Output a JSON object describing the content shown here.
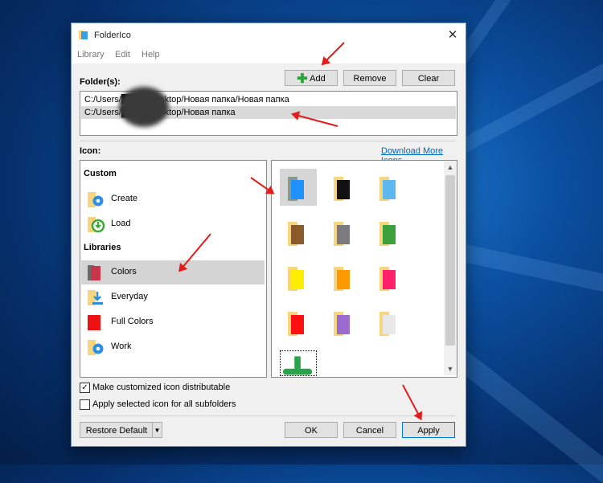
{
  "window": {
    "title": "FolderIco"
  },
  "menu": [
    "Library",
    "Edit",
    "Help"
  ],
  "folders": {
    "label": "Folder(s):",
    "add_label": "Add",
    "remove_label": "Remove",
    "clear_label": "Clear",
    "paths": [
      "C:/Users/████/Desktop/Новая папка/Новая папка",
      "C:/Users/████/Desktop/Новая папка"
    ],
    "selected_index": 1
  },
  "icon": {
    "label": "Icon:",
    "download_link": "Download More Icons",
    "custom_header": "Custom",
    "custom_items": [
      {
        "label": "Create",
        "icon": "gear-folder-icon"
      },
      {
        "label": "Load",
        "icon": "load-folder-icon"
      }
    ],
    "libraries_header": "Libraries",
    "library_items": [
      {
        "label": "Colors",
        "icon": "colors-folder-icon",
        "selected": true
      },
      {
        "label": "Everyday",
        "icon": "download-folder-icon",
        "selected": false
      },
      {
        "label": "Full Colors",
        "icon": "red-folder-icon",
        "selected": false
      },
      {
        "label": "Work",
        "icon": "gear-folder-icon",
        "selected": false
      }
    ],
    "grid_colors": [
      "#1e90ff",
      "#111111",
      "#5cb8ee",
      "#8b5a2b",
      "#7a7a80",
      "#3ba13b",
      "#ffee00",
      "#ff9900",
      "#ff1f6b",
      "#ff1010",
      "#9b6bcf",
      "#e8e8e8"
    ],
    "partial_color": "#2aa44a"
  },
  "options": {
    "distributable_label": "Make customized icon distributable",
    "distributable_checked": true,
    "subfolders_label": "Apply selected icon for all subfolders",
    "subfolders_checked": false
  },
  "footer": {
    "restore_label": "Restore Default",
    "ok_label": "OK",
    "cancel_label": "Cancel",
    "apply_label": "Apply"
  },
  "colors": {
    "accent": "#0078d7",
    "annotation_arrow": "#e41c1c",
    "link": "#0066cc"
  }
}
